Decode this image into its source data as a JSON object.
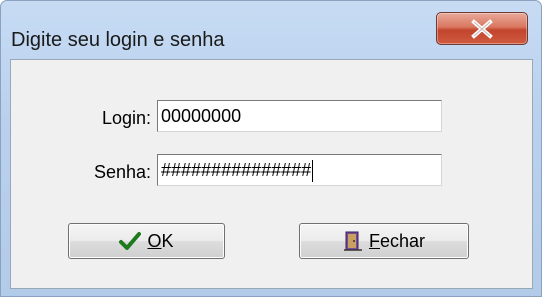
{
  "window": {
    "title": "Digite seu login e senha",
    "close_icon": "close-icon"
  },
  "form": {
    "login_label": "Login:",
    "login_value": "00000000",
    "password_label": "Senha:",
    "password_value": "###############"
  },
  "buttons": {
    "ok": {
      "icon": "checkmark-icon",
      "accel": "O",
      "rest": "K"
    },
    "close": {
      "icon": "exit-door-icon",
      "accel": "F",
      "rest": "echar"
    }
  },
  "colors": {
    "titlebar": "#b9d1ee",
    "close_button": "#c7482f",
    "check": "#1f7a1f"
  }
}
